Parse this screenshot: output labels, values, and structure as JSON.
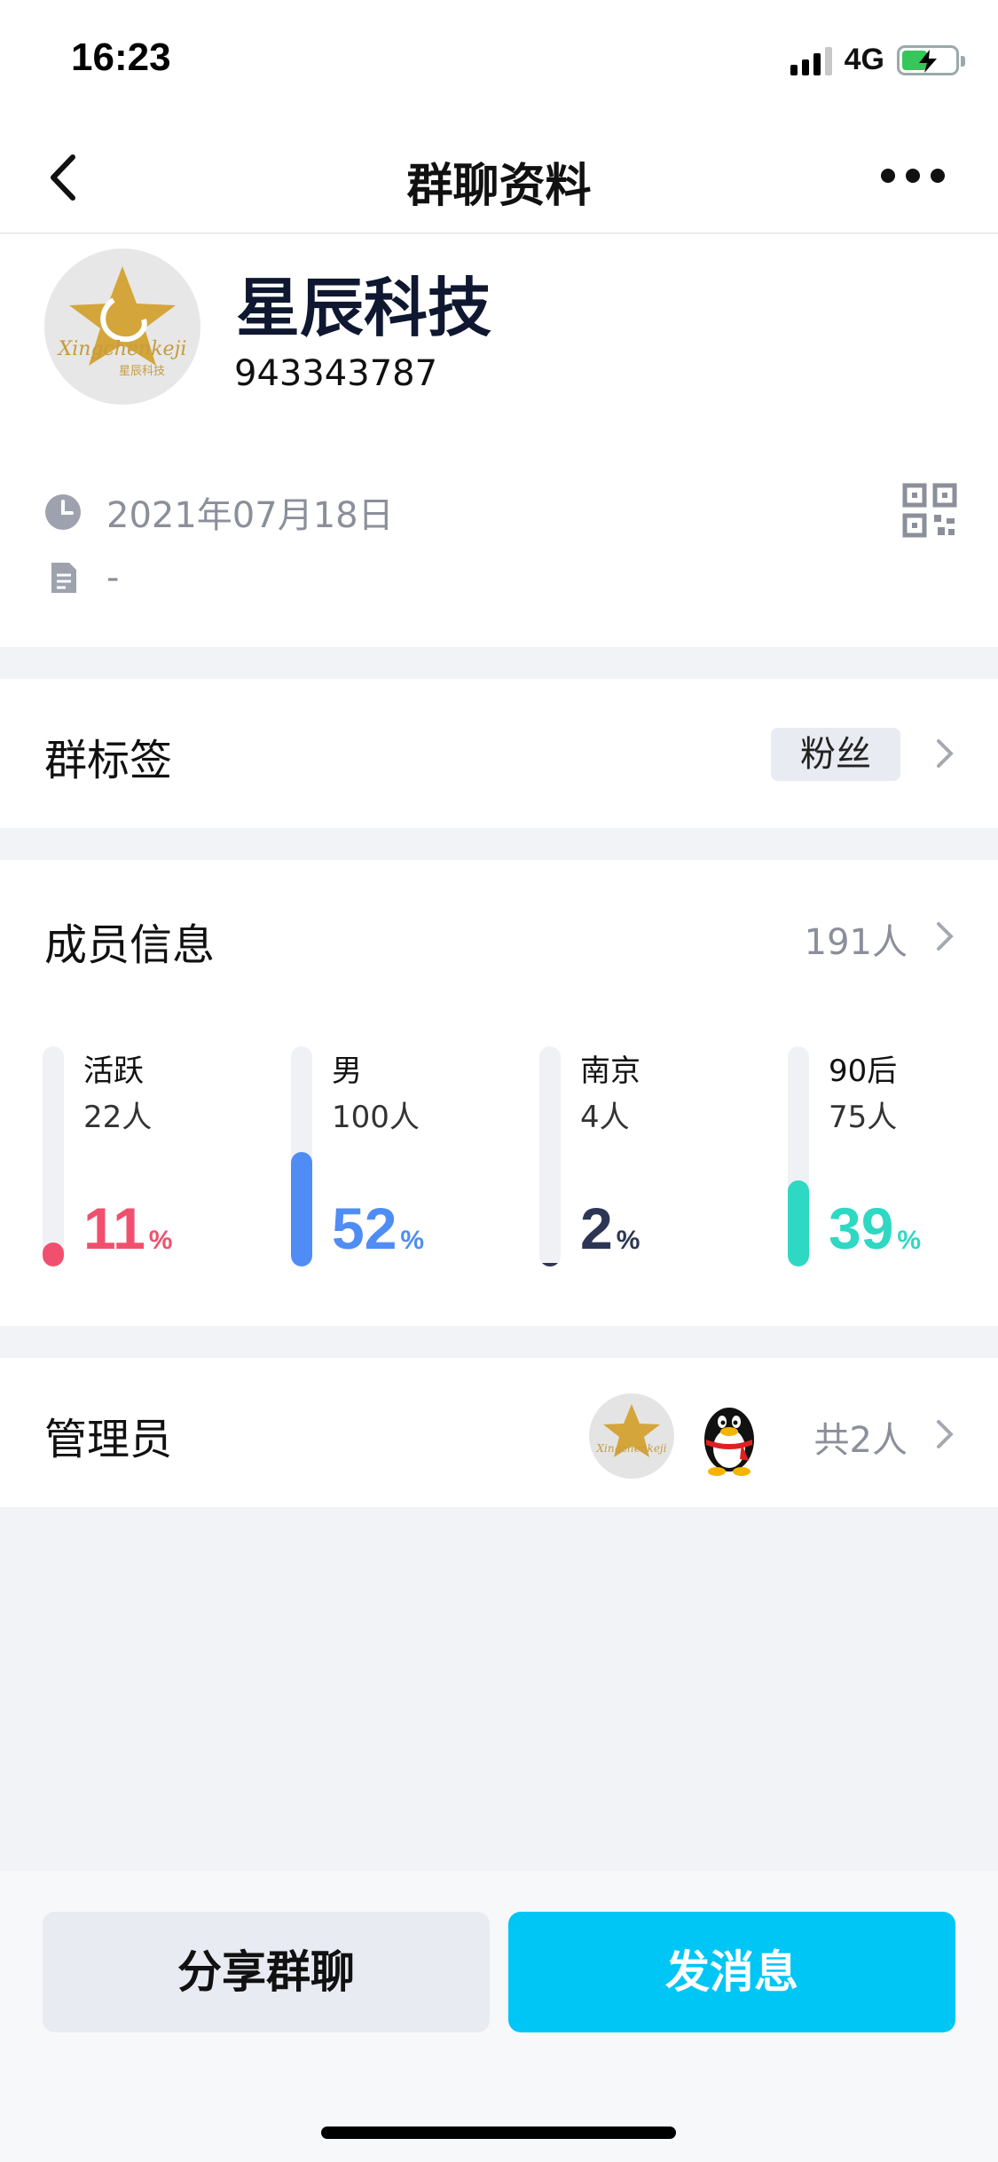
{
  "status_bar": {
    "time": "16:23",
    "network": "4G"
  },
  "nav": {
    "title": "群聊资料"
  },
  "profile": {
    "name": "星辰科技",
    "id": "943343787",
    "created_date": "2021年07月18日",
    "description": "-",
    "logo_text": "Xingchenkeji",
    "logo_subtext": "星辰科技"
  },
  "tags": {
    "label": "群标签",
    "tag": "粉丝"
  },
  "members": {
    "label": "成员信息",
    "count": "191人",
    "stats": [
      {
        "label": "活跃",
        "count": "22人",
        "percent": 11,
        "color": "#f0506e"
      },
      {
        "label": "男",
        "count": "100人",
        "percent": 52,
        "color": "#4f8df5"
      },
      {
        "label": "南京",
        "count": "4人",
        "percent": 2,
        "color": "#2c3554"
      },
      {
        "label": "90后",
        "count": "75人",
        "percent": 39,
        "color": "#2fd8c3"
      }
    ],
    "percent_symbol": "%"
  },
  "admins": {
    "label": "管理员",
    "count": "共2人"
  },
  "actions": {
    "share": "分享群聊",
    "send": "发消息"
  }
}
